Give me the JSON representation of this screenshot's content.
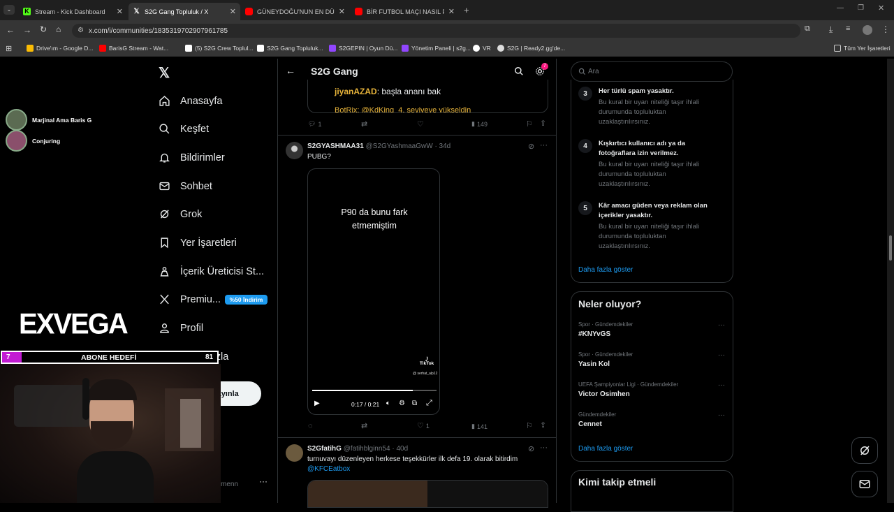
{
  "browser": {
    "tabs": [
      {
        "title": "Stream - Kick Dashboard",
        "color": "#53fc18",
        "active": false
      },
      {
        "title": "S2G Gang Topluluk / X",
        "color": "#ffffff",
        "active": true
      },
      {
        "title": "GÜNEYDOĞU'NUN EN DÜŞÜK",
        "color": "#ff0000",
        "active": false
      },
      {
        "title": "BİR FUTBOL MAÇI NASIL FACİA",
        "color": "#ff0000",
        "active": false
      }
    ],
    "url": "x.com/i/communities/1835319702907961785",
    "bookmarks": [
      {
        "label": "Drive'ım - Google D...",
        "color": "#fbbc04"
      },
      {
        "label": "BarisG Stream - Wat...",
        "color": "#ff0000"
      },
      {
        "label": "(5) S2G Crew Toplul...",
        "color": "#ffffff"
      },
      {
        "label": "S2G Gang Topluluk...",
        "color": "#ffffff"
      },
      {
        "label": "S2GEPIN | Oyun Dü...",
        "color": "#9146ff"
      },
      {
        "label": "Yönetim Paneli | s2g...",
        "color": "#9146ff"
      },
      {
        "label": "VR",
        "color": "#ffffff"
      },
      {
        "label": "S2G | Ready2.gg'de...",
        "color": "#dddddd"
      }
    ],
    "all_bookmarks": "Tüm Yer İşaretleri"
  },
  "overlay": {
    "viewers": [
      "Marjinal Ama Baris G",
      "Conjuring"
    ],
    "logo": "EXVEGA",
    "sub_goal": {
      "count": "7",
      "label": "ABONE HEDEFİ",
      "target": "81",
      "progress": 0.09
    }
  },
  "sidebar": {
    "items": [
      {
        "label": "Anasayfa",
        "icon": "home-icon"
      },
      {
        "label": "Keşfet",
        "icon": "search-icon"
      },
      {
        "label": "Bildirimler",
        "icon": "bell-icon"
      },
      {
        "label": "Sohbet",
        "icon": "mail-icon"
      },
      {
        "label": "Grok",
        "icon": "grok-icon"
      },
      {
        "label": "Yer İşaretleri",
        "icon": "bookmark-icon"
      },
      {
        "label": "İçerik Üreticisi St...",
        "icon": "creator-icon"
      },
      {
        "label": "Premiu...",
        "icon": "x-logo-icon"
      },
      {
        "label": "Profil",
        "icon": "person-icon"
      },
      {
        "label": "Daha fazla",
        "icon": "more-circle-icon"
      }
    ],
    "premium_badge": "%50 İndirim",
    "post_button": "Gönderi yayınla",
    "account_partial": "menn"
  },
  "header": {
    "title": "S2G Gang",
    "notif_count": "7"
  },
  "feed": {
    "top_post": {
      "quote_user": "jiyanAZAD",
      "quote_text": ": başla ananı bak",
      "quote_next": "BotRix: @KdKing_4. seviyeye yükseldin",
      "replies": "1",
      "likes": "",
      "views": "149"
    },
    "post1": {
      "name": "S2GYASHMAA31",
      "handle": "@S2GYashmaaGwW",
      "time": "· 34d",
      "text": "PUBG?",
      "video_caption": "P90 da bunu fark etmemiştim",
      "tiktok": "TikTok",
      "tiktok_user": "@ serhat_alp12",
      "video_time": "0:17 / 0:21",
      "video_progress": 0.81,
      "likes": "1",
      "views": "141"
    },
    "post2": {
      "name": "S2GfatihG",
      "handle": "@fatihblginn54",
      "time": "· 40d",
      "text": "turnuvayı düzenleyen herkese teşekkürler ilk defa 19. olarak bitirdim",
      "mention": "@KFCEatbox"
    }
  },
  "right": {
    "search_placeholder": "Ara",
    "rules": [
      {
        "num": "3",
        "title": "Her türlü spam yasaktır.",
        "desc": "Bu kural bir uyarı niteliği taşır ihlali durumunda topluluktan uzaklaştırılırsınız."
      },
      {
        "num": "4",
        "title": "Kışkırtıcı kullanıcı adı ya da fotoğraflara izin verilmez.",
        "desc": "Bu kural bir uyarı niteliği taşır ihlali durumunda topluluktan uzaklaştırılırsınız."
      },
      {
        "num": "5",
        "title": "Kâr amacı güden veya reklam olan içerikler yasaktır.",
        "desc": "Bu kural bir uyarı niteliği taşır ihlali durumunda topluluktan uzaklaştırılırsınız."
      }
    ],
    "show_more": "Daha fazla göster",
    "trends_title": "Neler oluyor?",
    "trends": [
      {
        "category": "Spor · Gündemdekiler",
        "name": "#KNYvGS"
      },
      {
        "category": "Spor · Gündemdekiler",
        "name": "Yasin Kol"
      },
      {
        "category": "UEFA Şampiyonlar Ligi · Gündemdekiler",
        "name": "Victor Osimhen"
      },
      {
        "category": "Gündemdekiler",
        "name": "Cennet"
      }
    ],
    "trends_more": "Daha fazla göster",
    "who_to_follow": "Kimi takip etmeli"
  },
  "colors": {
    "accent": "#1d9bf0",
    "border": "#2f3336",
    "muted": "#71767b",
    "overlay_pink": "#c21bd3"
  }
}
